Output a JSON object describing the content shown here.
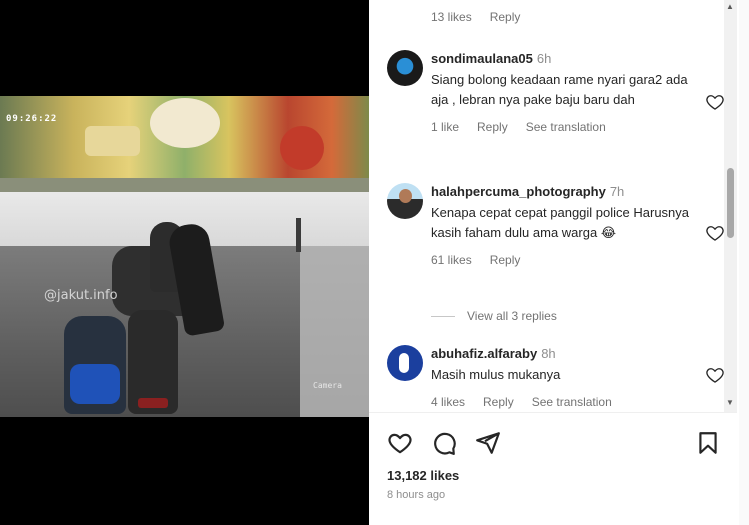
{
  "video": {
    "timestamp": "09:26:22",
    "watermark": "@jakut.info",
    "camera_label": "Camera"
  },
  "top_meta": {
    "likes": "13 likes",
    "reply": "Reply"
  },
  "comments": [
    {
      "username": "sondimaulana05",
      "time": "6h",
      "text": "Siang bolong keadaan rame nyari gara2 ada aja , lebran nya pake baju baru dah",
      "likes": "1 like",
      "reply": "Reply",
      "translate": "See translation"
    },
    {
      "username": "halahpercuma_photography",
      "time": "7h",
      "text": "Kenapa cepat cepat panggil police Harusnya kasih faham dulu ama warga 😂",
      "likes": "61 likes",
      "reply": "Reply",
      "view_replies": "View all 3 replies"
    },
    {
      "username": "abuhafiz.alfaraby",
      "time": "8h",
      "text": "Masih mulus mukanya",
      "likes": "4 likes",
      "reply": "Reply",
      "translate": "See translation"
    }
  ],
  "post": {
    "likes_count": "13,182 likes",
    "posted_ago": "8 hours ago"
  },
  "icons": {
    "heart": "heart-icon",
    "comment": "comment-icon",
    "share": "send-icon",
    "save": "bookmark-icon"
  },
  "colors": {
    "text": "#262626",
    "muted": "#737373",
    "background": "#ffffff"
  }
}
